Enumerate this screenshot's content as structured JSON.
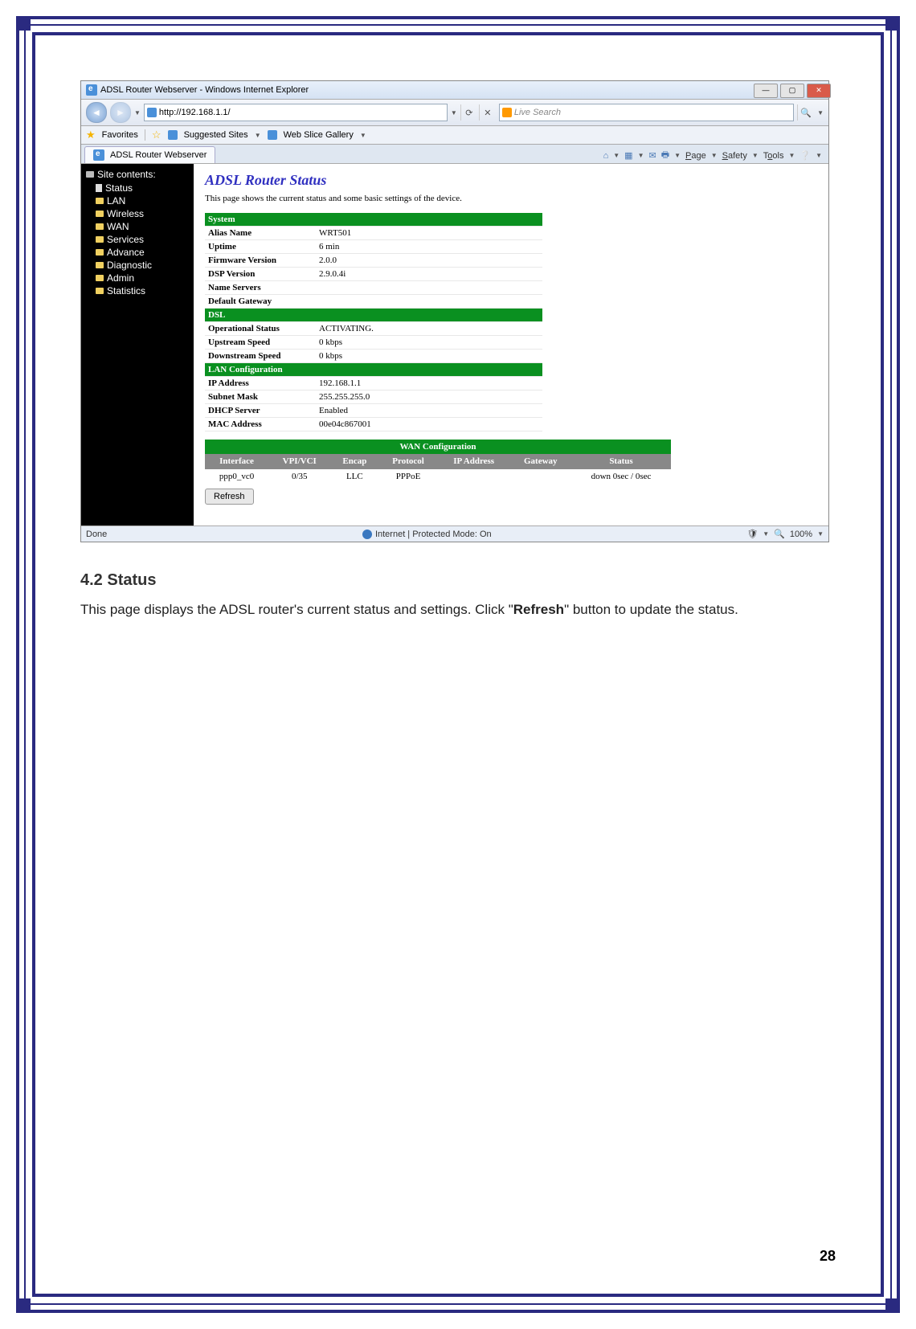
{
  "browser": {
    "window_title": "ADSL Router Webserver - Windows Internet Explorer",
    "url": "http://192.168.1.1/",
    "search_placeholder": "Live Search",
    "fav_label": "Favorites",
    "suggested": "Suggested Sites",
    "webslice": "Web Slice Gallery",
    "tab_title": "ADSL Router Webserver",
    "cmd_page": "Page",
    "cmd_safety": "Safety",
    "cmd_tools": "Tools",
    "status_left": "Done",
    "status_mid": "Internet | Protected Mode: On",
    "zoom": "100%"
  },
  "sidebar": {
    "header": "Site contents:",
    "items": [
      "Status",
      "LAN",
      "Wireless",
      "WAN",
      "Services",
      "Advance",
      "Diagnostic",
      "Admin",
      "Statistics"
    ]
  },
  "page": {
    "title": "ADSL Router Status",
    "desc": "This page shows the current status and some basic settings of the device."
  },
  "system": {
    "header": "System",
    "alias_l": "Alias Name",
    "alias_v": "WRT501",
    "uptime_l": "Uptime",
    "uptime_v": "6 min",
    "fw_l": "Firmware Version",
    "fw_v": "2.0.0",
    "dsp_l": "DSP Version",
    "dsp_v": "2.9.0.4i",
    "ns_l": "Name Servers",
    "ns_v": "",
    "gw_l": "Default Gateway",
    "gw_v": ""
  },
  "dsl": {
    "header": "DSL",
    "op_l": "Operational Status",
    "op_v": "ACTIVATING.",
    "up_l": "Upstream Speed",
    "up_v": "0 kbps",
    "dn_l": "Downstream Speed",
    "dn_v": "0 kbps"
  },
  "lan": {
    "header": "LAN Configuration",
    "ip_l": "IP Address",
    "ip_v": "192.168.1.1",
    "sm_l": "Subnet Mask",
    "sm_v": "255.255.255.0",
    "dhcp_l": "DHCP Server",
    "dhcp_v": "Enabled",
    "mac_l": "MAC Address",
    "mac_v": "00e04c867001"
  },
  "wan": {
    "header": "WAN Configuration",
    "cols": {
      "if": "Interface",
      "vpi": "VPI/VCI",
      "enc": "Encap",
      "proto": "Protocol",
      "ip": "IP Address",
      "gw": "Gateway",
      "st": "Status"
    },
    "row": {
      "if": "ppp0_vc0",
      "vpi": "0/35",
      "enc": "LLC",
      "proto": "PPPoE",
      "ip": "",
      "gw": "",
      "st": "down 0sec / 0sec"
    },
    "refresh": "Refresh"
  },
  "doc": {
    "heading": "4.2 Status",
    "body_1": "This page displays the ADSL router's current status and settings. Click \"",
    "body_b": "Refresh",
    "body_2": "\" button to update the status.",
    "page_num": "28"
  }
}
